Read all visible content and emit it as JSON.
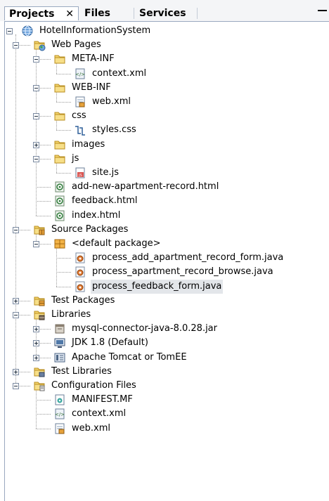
{
  "tabs": [
    {
      "label": "Projects",
      "close": "✕",
      "active": true
    },
    {
      "label": "Files"
    },
    {
      "label": "Services"
    }
  ],
  "tree": [
    {
      "id": "root",
      "label": "HotelInformationSystem",
      "icon": "globe-project-icon",
      "expander": "minus"
    },
    {
      "id": "web-pages",
      "label": "Web Pages",
      "icon": "web-pages-folder-icon",
      "expander": "minus"
    },
    {
      "id": "meta-inf",
      "label": "META-INF",
      "icon": "folder-icon",
      "expander": "minus"
    },
    {
      "id": "context-xml",
      "label": "context.xml",
      "icon": "xml-config-file-icon"
    },
    {
      "id": "web-inf",
      "label": "WEB-INF",
      "icon": "folder-icon",
      "expander": "minus"
    },
    {
      "id": "web-xml",
      "label": "web.xml",
      "icon": "web-xml-file-icon"
    },
    {
      "id": "css",
      "label": "css",
      "icon": "folder-icon",
      "expander": "minus"
    },
    {
      "id": "styles-css",
      "label": "styles.css",
      "icon": "css-file-icon"
    },
    {
      "id": "images",
      "label": "images",
      "icon": "folder-icon",
      "expander": "plus"
    },
    {
      "id": "js",
      "label": "js",
      "icon": "folder-icon",
      "expander": "minus"
    },
    {
      "id": "site-js",
      "label": "site.js",
      "icon": "js-file-icon"
    },
    {
      "id": "add-new",
      "label": "add-new-apartment-record.html",
      "icon": "html-file-icon"
    },
    {
      "id": "feedback",
      "label": "feedback.html",
      "icon": "html-file-icon"
    },
    {
      "id": "index",
      "label": "index.html",
      "icon": "html-file-icon"
    },
    {
      "id": "source-packages",
      "label": "Source Packages",
      "icon": "source-packages-icon",
      "expander": "minus"
    },
    {
      "id": "default-package",
      "label": "<default package>",
      "icon": "package-icon",
      "expander": "minus"
    },
    {
      "id": "proc-add",
      "label": "process_add_apartment_record_form.java",
      "icon": "java-file-icon"
    },
    {
      "id": "proc-browse",
      "label": "process_apartment_record_browse.java",
      "icon": "java-file-icon"
    },
    {
      "id": "proc-feedback",
      "label": "process_feedback_form.java",
      "icon": "java-file-icon",
      "selected": true
    },
    {
      "id": "test-packages",
      "label": "Test Packages",
      "icon": "test-packages-icon",
      "expander": "plus"
    },
    {
      "id": "libraries",
      "label": "Libraries",
      "icon": "libraries-icon",
      "expander": "minus"
    },
    {
      "id": "mysql",
      "label": "mysql-connector-java-8.0.28.jar",
      "icon": "jar-file-icon",
      "expander": "plus"
    },
    {
      "id": "jdk",
      "label": "JDK 1.8 (Default)",
      "icon": "jdk-icon",
      "expander": "plus"
    },
    {
      "id": "tomcat",
      "label": "Apache Tomcat or TomEE",
      "icon": "server-icon",
      "expander": "plus"
    },
    {
      "id": "test-libraries",
      "label": "Test Libraries",
      "icon": "test-libraries-icon",
      "expander": "plus"
    },
    {
      "id": "config-files",
      "label": "Configuration Files",
      "icon": "config-files-icon",
      "expander": "minus"
    },
    {
      "id": "manifest",
      "label": "MANIFEST.MF",
      "icon": "manifest-file-icon"
    },
    {
      "id": "cfg-context",
      "label": "context.xml",
      "icon": "xml-config-file-icon"
    },
    {
      "id": "cfg-web",
      "label": "web.xml",
      "icon": "web-xml-file-icon"
    }
  ]
}
